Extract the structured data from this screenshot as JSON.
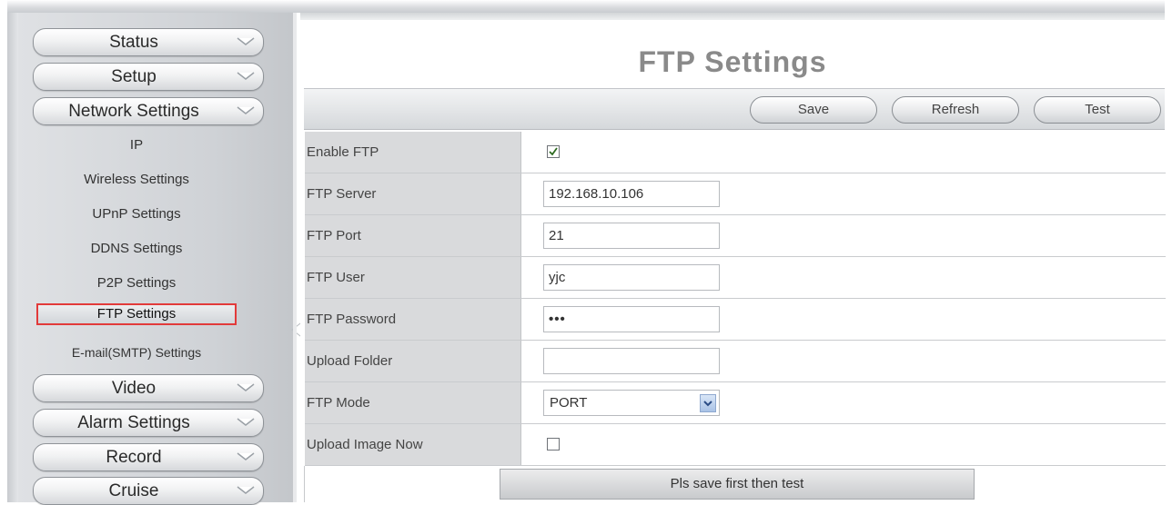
{
  "sidebar": {
    "menus_top": [
      {
        "label": "Status"
      },
      {
        "label": "Setup"
      },
      {
        "label": "Network Settings"
      }
    ],
    "subitems": [
      {
        "label": "IP"
      },
      {
        "label": "Wireless Settings"
      },
      {
        "label": "UPnP Settings"
      },
      {
        "label": "DDNS Settings"
      },
      {
        "label": "P2P Settings"
      },
      {
        "label": "FTP Settings",
        "active": true
      },
      {
        "label": "E-mail(SMTP) Settings"
      }
    ],
    "menus_bottom": [
      {
        "label": "Video"
      },
      {
        "label": "Alarm Settings"
      },
      {
        "label": "Record"
      },
      {
        "label": "Cruise"
      }
    ]
  },
  "main": {
    "title": "FTP Settings",
    "toolbar": {
      "save_label": "Save",
      "refresh_label": "Refresh",
      "test_label": "Test"
    },
    "form": {
      "enable_ftp": {
        "label": "Enable FTP",
        "checked": true
      },
      "ftp_server": {
        "label": "FTP Server",
        "value": "192.168.10.106"
      },
      "ftp_port": {
        "label": "FTP Port",
        "value": "21"
      },
      "ftp_user": {
        "label": "FTP User",
        "value": "yjc"
      },
      "ftp_password": {
        "label": "FTP Password",
        "value": "•••"
      },
      "upload_folder": {
        "label": "Upload Folder",
        "value": ""
      },
      "ftp_mode": {
        "label": "FTP Mode",
        "value": "PORT"
      },
      "upload_image_now": {
        "label": "Upload Image Now",
        "checked": false
      }
    },
    "test_button_label": "Pls save first then test"
  },
  "colors": {
    "active_outline": "#e23a3a",
    "title_gray": "#8a8a8a",
    "label_bg": "#d9dadc"
  }
}
